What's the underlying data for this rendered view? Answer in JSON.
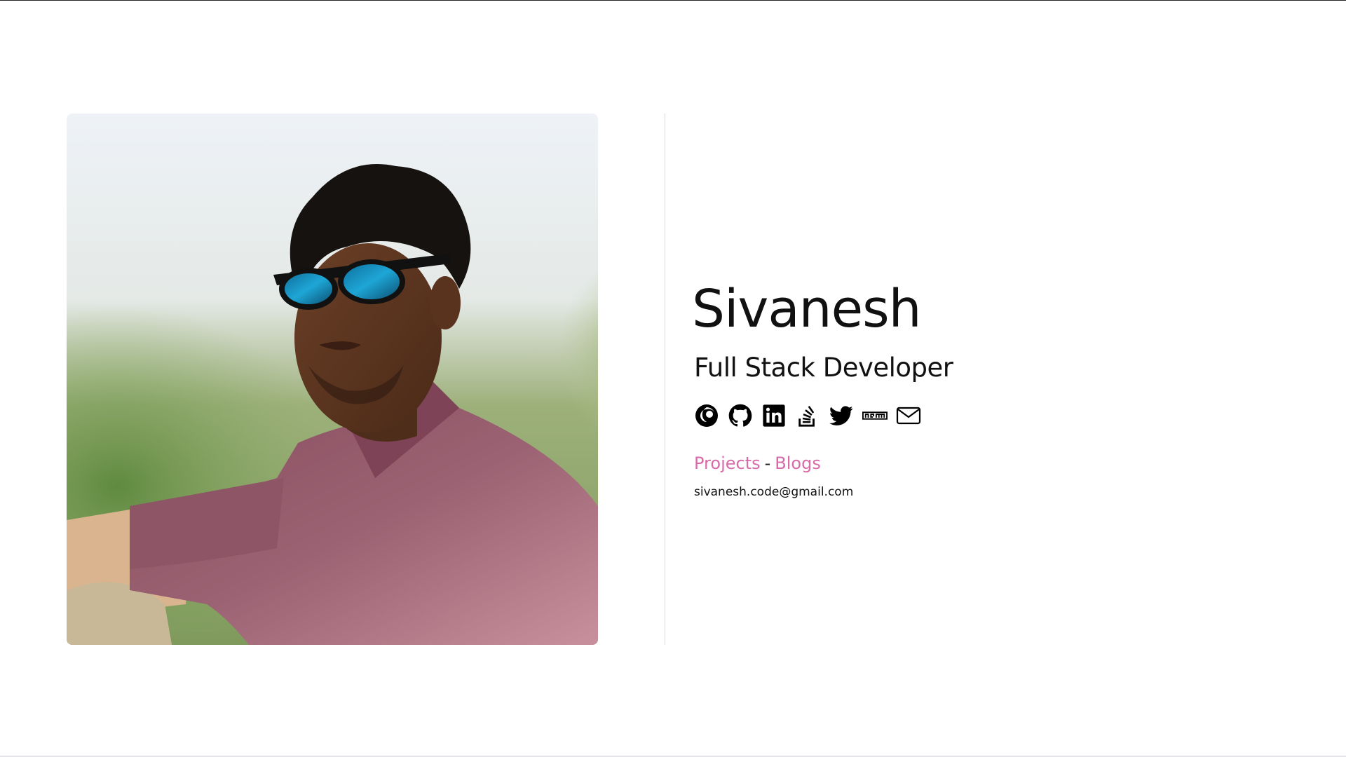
{
  "profile": {
    "name": "Sivanesh",
    "role": "Full Stack Developer",
    "email": "sivanesh.code@gmail.com",
    "photo_icon": "profile-photo"
  },
  "socials": [
    {
      "name": "pokeball-icon"
    },
    {
      "name": "github-icon"
    },
    {
      "name": "linkedin-icon"
    },
    {
      "name": "stackoverflow-icon"
    },
    {
      "name": "twitter-icon"
    },
    {
      "name": "npm-icon"
    },
    {
      "name": "mail-icon"
    }
  ],
  "links": {
    "projects": "Projects",
    "separator": "-",
    "blogs": "Blogs"
  },
  "colors": {
    "link": "#d96aa8",
    "text": "#111111",
    "divider": "#dcdcdc"
  }
}
